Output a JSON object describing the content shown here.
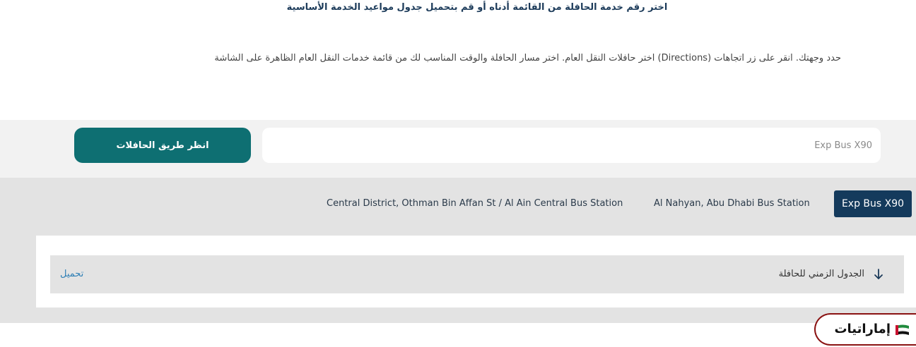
{
  "header": {
    "heading": "اختر رقم خدمة الحافلة من القائمة أدناه أو قم بتحميل جدول مواعيد الخدمة الأساسية",
    "instructions": "حدد وجهتك. انقر على زر اتجاهات (Directions) اختر حافلات النقل العام. اختر مسار الحافلة والوقت المناسب لك من قائمة خدمات النقل العام الظاهرة على الشاشة"
  },
  "search": {
    "value": "Exp Bus X90",
    "button_label": "انظر طريق الحافلات"
  },
  "route": {
    "code": "Exp Bus X90",
    "origin": "Al Nahyan, Abu Dhabi Bus Station",
    "destination": "Central District, Othman Bin Affan St / Al Ain Central Bus Station"
  },
  "schedule": {
    "label": "الجدول الزمني للحافلة",
    "download_label": "تحميل",
    "arrow_icon": "arrow-down-icon"
  },
  "brand": {
    "name": "إماراتيات",
    "icon": "uae-flag-icon",
    "accent_color": "#8a1212"
  },
  "colors": {
    "primary_button": "#0e6f72",
    "route_chip": "#143a5c",
    "link": "#2e7fb5"
  }
}
